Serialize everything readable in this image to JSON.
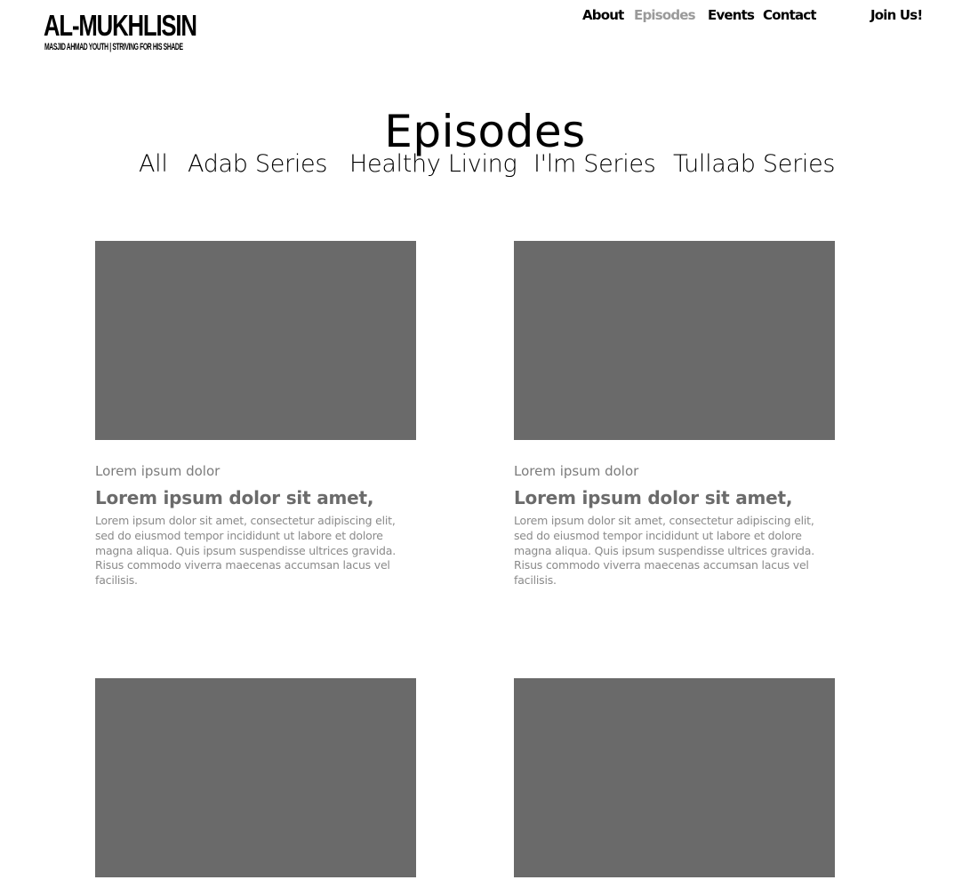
{
  "brand": {
    "title": "AL-MUKHLISIN",
    "tagline": "MASJID AHMAD YOUTH | STRIVING FOR HIS SHADE"
  },
  "nav": {
    "items": [
      {
        "label": "About"
      },
      {
        "label": "Episodes",
        "active": true
      },
      {
        "label": "Events"
      },
      {
        "label": "Contact"
      }
    ],
    "join_label": "Join Us!"
  },
  "page": {
    "title": "Episodes"
  },
  "filters": [
    {
      "label": "All"
    },
    {
      "label": "Adab Series"
    },
    {
      "label": "Healthy Living"
    },
    {
      "label": "I'lm Series"
    },
    {
      "label": "Tullaab Series"
    }
  ],
  "episodes": [
    {
      "meta": "Lorem ipsum dolor",
      "title": "Lorem ipsum dolor sit amet,",
      "body": "Lorem ipsum dolor sit amet, consectetur adipiscing elit, sed do eiusmod tempor incididunt ut labore et dolore magna aliqua. Quis ipsum suspendisse ultrices gravida. Risus commodo viverra maecenas accumsan lacus vel facilisis."
    },
    {
      "meta": "Lorem ipsum dolor",
      "title": "Lorem ipsum dolor sit amet,",
      "body": "Lorem ipsum dolor sit amet, consectetur adipiscing elit, sed do eiusmod tempor incididunt ut labore et dolore magna aliqua. Quis ipsum suspendisse ultrices gravida. Risus commodo viverra maecenas accumsan lacus vel facilisis."
    },
    {},
    {}
  ],
  "colors": {
    "thumbnail": "#6a6a6a",
    "active_nav": "#9a9a9a",
    "card_text": "#8a8a8a"
  }
}
